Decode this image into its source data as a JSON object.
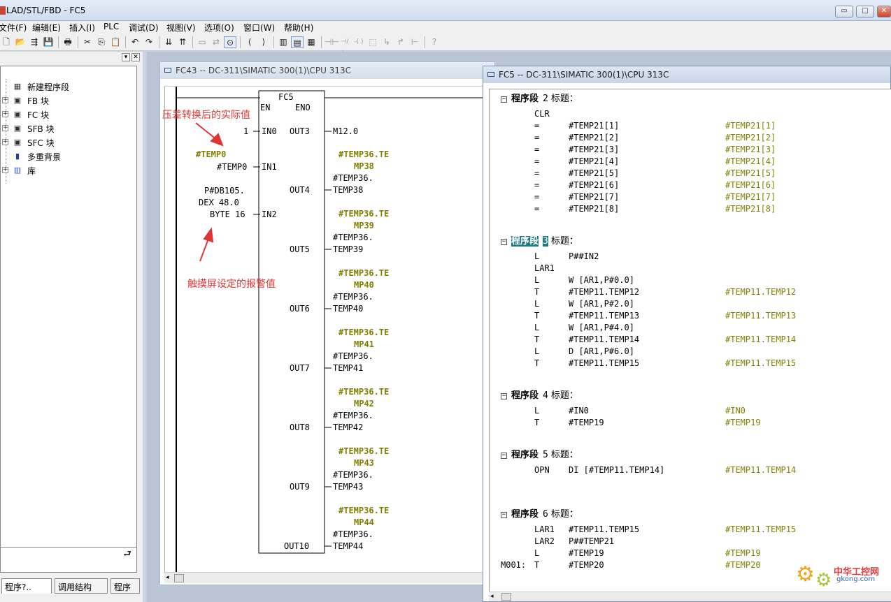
{
  "app": {
    "title": "LAD/STL/FBD  - FC5"
  },
  "window_controls": {
    "minimize": "▭",
    "maximize": "□",
    "close": "✕"
  },
  "menu": [
    "文件(F)",
    "编辑(E)",
    "插入(I)",
    "PLC",
    "调试(D)",
    "视图(V)",
    "选项(O)",
    "窗口(W)",
    "帮助(H)"
  ],
  "toolbar_icons": [
    "new-icon",
    "open-icon",
    "accessible-nodes-icon",
    "save-icon",
    "print-icon",
    "cut-icon",
    "copy-icon",
    "paste-icon",
    "undo-icon",
    "redo-icon",
    "download-icon",
    "upload-icon",
    "monitor-icon",
    "network-icon",
    "glasses-icon",
    "prev-bookmark-icon",
    "next-bookmark-icon",
    "overview-icon",
    "details-icon",
    "lad-icon",
    "stl-icon",
    "fbd-icon",
    "contact-no-icon",
    "contact-nc-icon",
    "coil-icon",
    "empty-box-icon",
    "branch-open-icon",
    "branch-close-icon",
    "connection-icon",
    "help-icon"
  ],
  "sidebar": {
    "items": [
      {
        "label": "新建程序段",
        "icon": "new-network-icon",
        "expandable": false
      },
      {
        "label": "FB 块",
        "icon": "fb-block-icon",
        "expandable": true
      },
      {
        "label": "FC 块",
        "icon": "fc-block-icon",
        "expandable": true
      },
      {
        "label": "SFB 块",
        "icon": "sfb-block-icon",
        "expandable": true
      },
      {
        "label": "SFC 块",
        "icon": "sfc-block-icon",
        "expandable": true
      },
      {
        "label": "多重背景",
        "icon": "multi-instance-icon",
        "expandable": false
      },
      {
        "label": "库",
        "icon": "library-icon",
        "expandable": true
      }
    ],
    "tabs": [
      "程序?..",
      "调用结构",
      "程序"
    ],
    "pin_label": "⮐"
  },
  "fc43": {
    "title": "FC43 -- DC-311\\SIMATIC 300(1)\\CPU 313C",
    "block": {
      "name": "FC5",
      "en": "EN",
      "eno": "ENO"
    },
    "inputs": [
      {
        "pin": "IN0",
        "value": "1"
      },
      {
        "pin": "IN1",
        "value": "#TEMP0",
        "comment": "#TEMP0"
      },
      {
        "pin": "IN2",
        "value_lines": [
          "P#DB105.",
          "DEX 48.0",
          "BYTE 16"
        ]
      }
    ],
    "outputs": [
      {
        "pin": "OUT3",
        "value": "M12.0"
      },
      {
        "pin": "OUT4",
        "comment": [
          "#TEMP36.TE",
          "MP38"
        ],
        "value_lines": [
          "#TEMP36.",
          "TEMP38"
        ]
      },
      {
        "pin": "OUT5",
        "comment": [
          "#TEMP36.TE",
          "MP39"
        ],
        "value_lines": [
          "#TEMP36.",
          "TEMP39"
        ]
      },
      {
        "pin": "OUT6",
        "comment": [
          "#TEMP36.TE",
          "MP40"
        ],
        "value_lines": [
          "#TEMP36.",
          "TEMP40"
        ]
      },
      {
        "pin": "OUT7",
        "comment": [
          "#TEMP36.TE",
          "MP41"
        ],
        "value_lines": [
          "#TEMP36.",
          "TEMP41"
        ]
      },
      {
        "pin": "OUT8",
        "comment": [
          "#TEMP36.TE",
          "MP42"
        ],
        "value_lines": [
          "#TEMP36.",
          "TEMP42"
        ]
      },
      {
        "pin": "OUT9",
        "comment": [
          "#TEMP36.TE",
          "MP43"
        ],
        "value_lines": [
          "#TEMP36.",
          "TEMP43"
        ]
      },
      {
        "pin": "OUT10",
        "comment": [
          "#TEMP36.TE",
          "MP44"
        ],
        "value_lines": [
          "#TEMP36.",
          "TEMP44"
        ]
      }
    ],
    "annotations": {
      "top": "压差转换后的实际值",
      "bottom": "触摸屏设定的报警值"
    }
  },
  "fc5": {
    "title": "FC5 -- DC-311\\SIMATIC 300(1)\\CPU 313C",
    "networks": [
      {
        "label": "程序段",
        "num": "2",
        "title_label": "标题：",
        "selected": false,
        "lines": [
          {
            "op": "CLR",
            "arg": "",
            "cmt": ""
          },
          {
            "op": "=",
            "arg": "#TEMP21[1]",
            "cmt": "#TEMP21[1]"
          },
          {
            "op": "=",
            "arg": "#TEMP21[2]",
            "cmt": "#TEMP21[2]"
          },
          {
            "op": "=",
            "arg": "#TEMP21[3]",
            "cmt": "#TEMP21[3]"
          },
          {
            "op": "=",
            "arg": "#TEMP21[4]",
            "cmt": "#TEMP21[4]"
          },
          {
            "op": "=",
            "arg": "#TEMP21[5]",
            "cmt": "#TEMP21[5]"
          },
          {
            "op": "=",
            "arg": "#TEMP21[6]",
            "cmt": "#TEMP21[6]"
          },
          {
            "op": "=",
            "arg": "#TEMP21[7]",
            "cmt": "#TEMP21[7]"
          },
          {
            "op": "=",
            "arg": "#TEMP21[8]",
            "cmt": "#TEMP21[8]"
          }
        ]
      },
      {
        "label": "程序段",
        "num": "3",
        "title_label": "标题：",
        "selected": true,
        "lines": [
          {
            "op": "L",
            "arg": "P##IN2",
            "cmt": ""
          },
          {
            "op": "LAR1",
            "arg": "",
            "cmt": ""
          },
          {
            "op": "L",
            "arg": "W [AR1,P#0.0]",
            "cmt": ""
          },
          {
            "op": "T",
            "arg": "#TEMP11.TEMP12",
            "cmt": "#TEMP11.TEMP12"
          },
          {
            "op": "L",
            "arg": "W [AR1,P#2.0]",
            "cmt": ""
          },
          {
            "op": "T",
            "arg": "#TEMP11.TEMP13",
            "cmt": "#TEMP11.TEMP13"
          },
          {
            "op": "L",
            "arg": "W [AR1,P#4.0]",
            "cmt": ""
          },
          {
            "op": "T",
            "arg": "#TEMP11.TEMP14",
            "cmt": "#TEMP11.TEMP14"
          },
          {
            "op": "L",
            "arg": "D [AR1,P#6.0]",
            "cmt": ""
          },
          {
            "op": "T",
            "arg": "#TEMP11.TEMP15",
            "cmt": "#TEMP11.TEMP15"
          }
        ]
      },
      {
        "label": "程序段",
        "num": "4",
        "title_label": "标题：",
        "selected": false,
        "lines": [
          {
            "op": "L",
            "arg": "#IN0",
            "cmt": "#IN0"
          },
          {
            "op": "T",
            "arg": "#TEMP19",
            "cmt": "#TEMP19"
          }
        ]
      },
      {
        "label": "程序段",
        "num": "5",
        "title_label": "标题：",
        "selected": false,
        "lines": [
          {
            "op": "OPN",
            "arg": "DI [#TEMP11.TEMP14]",
            "cmt": "#TEMP11.TEMP14"
          }
        ]
      },
      {
        "label": "程序段",
        "num": "6",
        "title_label": "标题：",
        "selected": false,
        "lines": [
          {
            "op": "LAR1",
            "arg": "#TEMP11.TEMP15",
            "cmt": "#TEMP11.TEMP15"
          },
          {
            "op": "LAR2",
            "arg": "P##TEMP21",
            "cmt": ""
          },
          {
            "op": "L",
            "arg": "#TEMP19",
            "cmt": "#TEMP19"
          },
          {
            "op": "T",
            "arg": "#TEMP20",
            "cmt": "#TEMP20",
            "label": "M001:"
          }
        ]
      }
    ]
  },
  "watermark": {
    "name": "中华工控网",
    "url": "gkong.com"
  },
  "colors": {
    "comment": "#808000",
    "selection": "#1f7a80",
    "annotation": "#e03535"
  }
}
